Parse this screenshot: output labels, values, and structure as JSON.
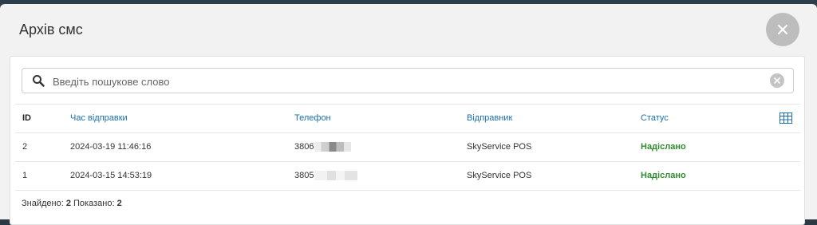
{
  "modal": {
    "title": "Архів смс"
  },
  "search": {
    "placeholder": "Введіть пошукове слово",
    "value": ""
  },
  "table": {
    "headers": {
      "id": "ID",
      "sent_time": "Час відправки",
      "phone": "Телефон",
      "sender": "Відправник",
      "status": "Статус"
    },
    "rows": [
      {
        "id": "2",
        "sent_time": "2024-03-19 11:46:16",
        "phone": "3806",
        "sender": "SkyService POS",
        "status": "Надіслано"
      },
      {
        "id": "1",
        "sent_time": "2024-03-15 14:53:19",
        "phone": "3805",
        "sender": "SkyService POS",
        "status": "Надіслано"
      }
    ]
  },
  "footer": {
    "found_label": "Знайдено:",
    "found_count": "2",
    "shown_label": "Показано:",
    "shown_count": "2"
  },
  "colors": {
    "link": "#1a6fb0",
    "status_ok": "#2e8b2e",
    "close_bg": "#bdbdbd"
  },
  "icons": {
    "close": "close-icon",
    "search": "search-icon",
    "clear": "clear-icon",
    "columns": "grid-icon"
  }
}
